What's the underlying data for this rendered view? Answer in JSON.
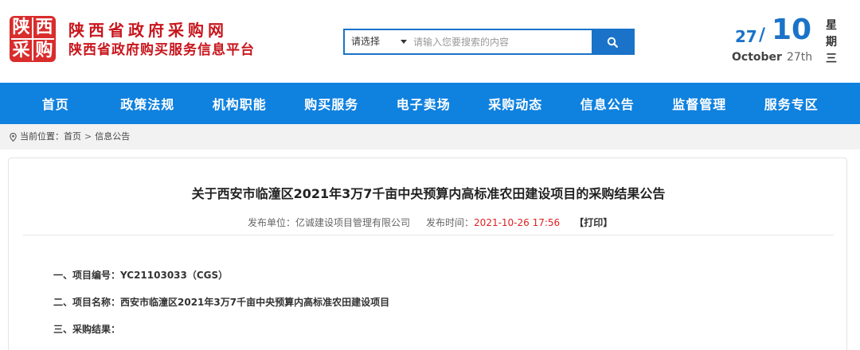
{
  "header": {
    "logo": {
      "chars": [
        "陕",
        "西",
        "采",
        "购"
      ],
      "color": "#d92c2c"
    },
    "title": "陕西省政府采购网",
    "subtitle": "陕西省政府购买服务信息平台",
    "title_color": "#c8161d"
  },
  "search": {
    "select_label": "请选择",
    "placeholder": "请输入您要搜索的内容",
    "button_icon": "search-icon",
    "accent": "#1a73c8"
  },
  "date": {
    "day": "27",
    "slash": "/",
    "month": "10",
    "month_en": "October",
    "day_en": "27th",
    "weekday_chars": [
      "星",
      "期",
      "三"
    ]
  },
  "nav": {
    "items": [
      "首页",
      "政策法规",
      "机构职能",
      "购买服务",
      "电子卖场",
      "采购动态",
      "信息公告",
      "监督管理",
      "服务专区"
    ],
    "bg": "#0f81df"
  },
  "breadcrumb": {
    "prefix": "当前位置：",
    "home": "首页",
    "separator": ">",
    "current": "信息公告"
  },
  "article": {
    "title": "关于西安市临潼区2021年3万7千亩中央预算内高标准农田建设项目的采购结果公告",
    "publisher_label": "发布单位：",
    "publisher": "亿诚建设项目管理有限公司",
    "time_label": "发布时间：",
    "time": "2021-10-26 17:56",
    "print_label": "【打印】",
    "time_color": "#dd2222",
    "lines": [
      "一、项目编号：YC21103033（CGS）",
      "二、项目名称：西安市临潼区2021年3万7千亩中央预算内高标准农田建设项目",
      "三、采购结果："
    ]
  }
}
